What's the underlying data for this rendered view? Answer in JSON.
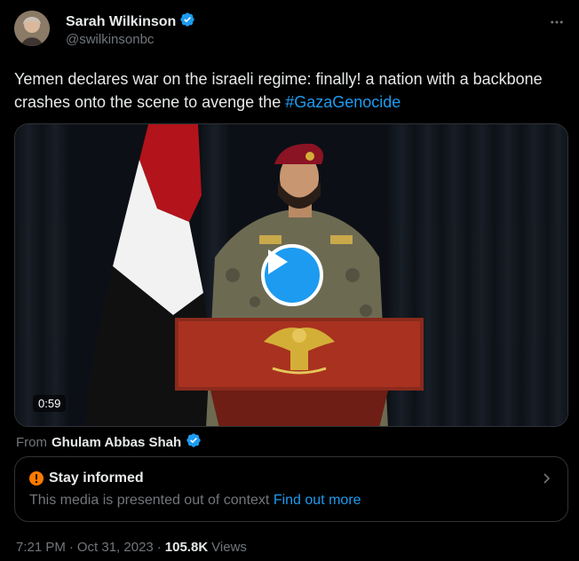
{
  "author": {
    "display_name": "Sarah Wilkinson",
    "handle": "@swilkinsonbc",
    "verified_icon": "verified-badge-icon"
  },
  "tweet": {
    "text": "Yemen declares war on the israeli regime: finally! a nation with a backbone crashes onto the scene to avenge the ",
    "hashtag": "#GazaGenocide"
  },
  "media": {
    "duration": "0:59",
    "play_icon": "play-icon"
  },
  "attribution": {
    "from_label": "From",
    "from_name": "Ghulam Abbas Shah"
  },
  "context_note": {
    "title": "Stay informed",
    "body": "This media is presented out of context",
    "link": "Find out more",
    "icon": "warning-circle-icon"
  },
  "meta": {
    "time": "7:21 PM",
    "separator": "·",
    "date": "Oct 31, 2023",
    "views_count": "105.8K",
    "views_label": "Views"
  },
  "colors": {
    "accent": "#1d9bf0",
    "warning": "#ff7a00",
    "background": "#000000",
    "muted": "#71767b"
  }
}
